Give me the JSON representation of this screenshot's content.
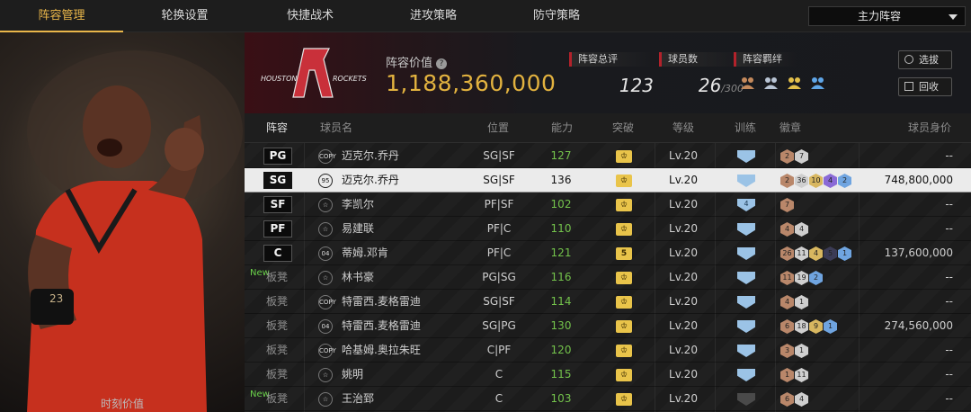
{
  "tabs": [
    {
      "label": "阵容管理",
      "active": true
    },
    {
      "label": "轮换设置",
      "active": false
    },
    {
      "label": "快捷战术",
      "active": false
    },
    {
      "label": "进攻策略",
      "active": false
    },
    {
      "label": "防守策略",
      "active": false
    }
  ],
  "squad_select": {
    "value": "主力阵容",
    "icon": "chevron-down-icon"
  },
  "player_art": {
    "caption": "时刻价值"
  },
  "header": {
    "team_logo_text": "HOUSTON ROCKETS",
    "value_label": "阵容价值",
    "value": "1,188,360,000",
    "overall_label": "阵容总评",
    "overall_value": "123",
    "count_label": "球员数",
    "count_value": "26",
    "count_max": "/300",
    "bond_label": "阵容羁绊",
    "bond_icons": [
      "bond-icon-bronze",
      "bond-icon-silver",
      "bond-icon-gold",
      "bond-icon-blue"
    ],
    "btn_select": "选拔",
    "btn_recycle": "回收"
  },
  "columns": [
    "阵容",
    "球员名",
    "位置",
    "能力",
    "突破",
    "等级",
    "训练",
    "徽章",
    "球员身价"
  ],
  "badge_colors": {
    "bronze": "#b9876a",
    "silver": "#cfcfcf",
    "gold": "#d8b760",
    "purple": "#8a6ad6",
    "blue": "#6fa4e0",
    "dark": "#3b3b55"
  },
  "rows": [
    {
      "slot": "PG",
      "slot_type": "starter",
      "new": "",
      "tag": "COPY",
      "name": "迈克尔.乔丹",
      "position": "SG|SF",
      "ability": "127",
      "breakthrough": "",
      "level": "Lv.20",
      "training": "",
      "badges": [
        {
          "n": "2",
          "c": "bronze"
        },
        {
          "n": "7",
          "c": "silver"
        }
      ],
      "value": "--",
      "selected": false
    },
    {
      "slot": "SG",
      "slot_type": "starter",
      "new": "",
      "tag": "95",
      "name": "迈克尔.乔丹",
      "position": "SG|SF",
      "ability": "136",
      "breakthrough": "",
      "level": "Lv.20",
      "training": "",
      "badges": [
        {
          "n": "2",
          "c": "bronze"
        },
        {
          "n": "36",
          "c": "silver"
        },
        {
          "n": "10",
          "c": "gold"
        },
        {
          "n": "4",
          "c": "purple"
        },
        {
          "n": "2",
          "c": "blue"
        }
      ],
      "value": "748,800,000",
      "selected": true
    },
    {
      "slot": "SF",
      "slot_type": "starter",
      "new": "",
      "tag": "☆",
      "name": "李凯尔",
      "position": "PF|SF",
      "ability": "102",
      "breakthrough": "",
      "level": "Lv.20",
      "training": "4",
      "badges": [
        {
          "n": "7",
          "c": "bronze"
        }
      ],
      "value": "--",
      "selected": false
    },
    {
      "slot": "PF",
      "slot_type": "starter",
      "new": "",
      "tag": "☆",
      "name": "易建联",
      "position": "PF|C",
      "ability": "110",
      "breakthrough": "",
      "level": "Lv.20",
      "training": "",
      "badges": [
        {
          "n": "4",
          "c": "bronze"
        },
        {
          "n": "4",
          "c": "silver"
        }
      ],
      "value": "--",
      "selected": false
    },
    {
      "slot": "C",
      "slot_type": "starter",
      "new": "",
      "tag": "04",
      "name": "蒂姆.邓肯",
      "position": "PF|C",
      "ability": "121",
      "breakthrough": "5",
      "level": "Lv.20",
      "training": "",
      "badges": [
        {
          "n": "26",
          "c": "bronze"
        },
        {
          "n": "11",
          "c": "silver"
        },
        {
          "n": "4",
          "c": "gold"
        },
        {
          "n": "5",
          "c": "dark"
        },
        {
          "n": "1",
          "c": "blue"
        }
      ],
      "value": "137,600,000",
      "selected": false
    },
    {
      "slot": "板凳",
      "slot_type": "bench",
      "new": "New",
      "tag": "☆",
      "name": "林书豪",
      "position": "PG|SG",
      "ability": "116",
      "breakthrough": "",
      "level": "Lv.20",
      "training": "",
      "badges": [
        {
          "n": "11",
          "c": "bronze"
        },
        {
          "n": "19",
          "c": "silver"
        },
        {
          "n": "2",
          "c": "blue"
        }
      ],
      "value": "--",
      "selected": false
    },
    {
      "slot": "板凳",
      "slot_type": "bench",
      "new": "",
      "tag": "COPY",
      "name": "特雷西.麦格雷迪",
      "position": "SG|SF",
      "ability": "114",
      "breakthrough": "",
      "level": "Lv.20",
      "training": "",
      "badges": [
        {
          "n": "4",
          "c": "bronze"
        },
        {
          "n": "1",
          "c": "silver"
        }
      ],
      "value": "--",
      "selected": false
    },
    {
      "slot": "板凳",
      "slot_type": "bench",
      "new": "",
      "tag": "04",
      "name": "特雷西.麦格雷迪",
      "position": "SG|PG",
      "ability": "130",
      "breakthrough": "",
      "level": "Lv.20",
      "training": "",
      "badges": [
        {
          "n": "6",
          "c": "bronze"
        },
        {
          "n": "18",
          "c": "silver"
        },
        {
          "n": "9",
          "c": "gold"
        },
        {
          "n": "1",
          "c": "blue"
        }
      ],
      "value": "274,560,000",
      "selected": false
    },
    {
      "slot": "板凳",
      "slot_type": "bench",
      "new": "",
      "tag": "COPY",
      "name": "哈基姆.奥拉朱旺",
      "position": "C|PF",
      "ability": "120",
      "breakthrough": "",
      "level": "Lv.20",
      "training": "",
      "badges": [
        {
          "n": "3",
          "c": "bronze"
        },
        {
          "n": "1",
          "c": "silver"
        }
      ],
      "value": "--",
      "selected": false
    },
    {
      "slot": "板凳",
      "slot_type": "bench",
      "new": "",
      "tag": "☆",
      "name": "姚明",
      "position": "C",
      "ability": "115",
      "breakthrough": "",
      "level": "Lv.20",
      "training": "",
      "badges": [
        {
          "n": "1",
          "c": "bronze"
        },
        {
          "n": "11",
          "c": "silver"
        }
      ],
      "value": "--",
      "selected": false
    },
    {
      "slot": "板凳",
      "slot_type": "bench",
      "new": "New",
      "tag": "☆",
      "name": "王治郅",
      "position": "C",
      "ability": "103",
      "breakthrough": "",
      "level": "Lv.20",
      "training": "",
      "badges": [
        {
          "n": "6",
          "c": "bronze"
        },
        {
          "n": "4",
          "c": "silver"
        }
      ],
      "value": "--",
      "selected": false
    }
  ]
}
